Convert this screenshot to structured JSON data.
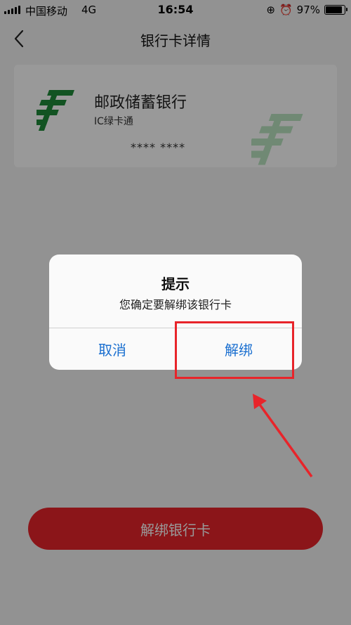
{
  "status_bar": {
    "carrier": "中国移动",
    "network": "4G",
    "time": "16:54",
    "battery_percent": "97%",
    "battery_level": 0.97
  },
  "nav": {
    "title": "银行卡详情",
    "back_icon": "chevron-left-icon"
  },
  "card": {
    "bank_name": "邮政储蓄银行",
    "card_type": "IC绿卡通",
    "card_number_masked": "**** ****",
    "logo_icon": "postal-bank-logo",
    "logo_color": "#1f8a3a"
  },
  "bottom_button": {
    "label": "解绑银行卡",
    "color": "#e8242a"
  },
  "dialog": {
    "title": "提示",
    "message": "您确定要解绑该银行卡",
    "cancel_label": "取消",
    "confirm_label": "解绑",
    "button_color": "#1a6fd0"
  },
  "annotation": {
    "color": "#e8242a"
  }
}
